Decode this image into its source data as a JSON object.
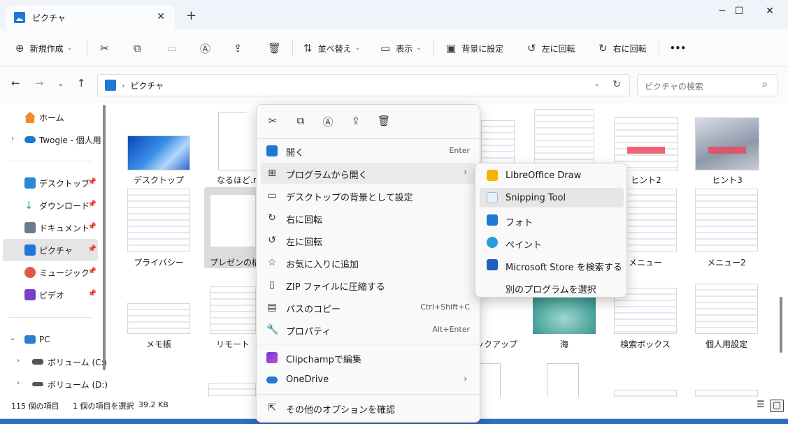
{
  "window": {
    "tab_title": "ピクチャ",
    "close_tab": "✕",
    "new_tab": "+",
    "minimize": "─",
    "maximize": "☐",
    "close": "✕"
  },
  "toolbar": {
    "new_label": "新規作成",
    "sort_label": "並べ替え",
    "view_label": "表示",
    "set_background_label": "背景に設定",
    "rotate_left_label": "左に回転",
    "rotate_right_label": "右に回転",
    "more_label": "•••"
  },
  "address": {
    "path": "ピクチャ",
    "search_placeholder": "ピクチャの検索"
  },
  "sidebar": {
    "items": [
      {
        "label": "ホーム",
        "color": "#f08c2a"
      },
      {
        "label": "Twogie - 個人用",
        "color": "#1e78d4"
      },
      {
        "label": "デスクトップ",
        "color": "#2b88d8"
      },
      {
        "label": "ダウンロード",
        "color": "#2e9c5a"
      },
      {
        "label": "ドキュメント",
        "color": "#6b7a8c"
      },
      {
        "label": "ピクチャ",
        "color": "#1e78d4"
      },
      {
        "label": "ミュージック",
        "color": "#e2574c"
      },
      {
        "label": "ビデオ",
        "color": "#7a3fc8"
      },
      {
        "label": "PC",
        "color": "#2a7fd0"
      },
      {
        "label": "ボリューム (C:)",
        "color": "#555555"
      },
      {
        "label": "ボリューム (D:)",
        "color": "#555555"
      }
    ]
  },
  "files": {
    "row1": [
      "デスクトップ",
      "なるほど.me",
      "",
      "",
      "ヒント2",
      "ヒント3"
    ],
    "row2": [
      "プライバシー",
      "プレゼンの構",
      "メニュー",
      "メニュー2"
    ],
    "row3": [
      "メモ帳",
      "リモート",
      "ックアップ",
      "海",
      "検索ボックス",
      "個人用設定"
    ]
  },
  "status": {
    "count": "115 個の項目",
    "selection": "1 個の項目を選択",
    "size": "39.2 KB"
  },
  "context_menu": {
    "items": [
      {
        "label": "開く",
        "shortcut": "Enter"
      },
      {
        "label": "プログラムから開く",
        "shortcut": "›"
      },
      {
        "label": "デスクトップの背景として設定",
        "shortcut": ""
      },
      {
        "label": "右に回転",
        "shortcut": ""
      },
      {
        "label": "左に回転",
        "shortcut": ""
      },
      {
        "label": "お気に入りに追加",
        "shortcut": ""
      },
      {
        "label": "ZIP ファイルに圧縮する",
        "shortcut": ""
      },
      {
        "label": "パスのコピー",
        "shortcut": "Ctrl+Shift+C"
      },
      {
        "label": "プロパティ",
        "shortcut": "Alt+Enter"
      },
      {
        "label": "Clipchampで編集",
        "shortcut": ""
      },
      {
        "label": "OneDrive",
        "shortcut": "›"
      },
      {
        "label": "その他のオプションを確認",
        "shortcut": ""
      }
    ]
  },
  "open_with_menu": {
    "items": [
      {
        "label": "LibreOffice Draw",
        "color": "#f5b400"
      },
      {
        "label": "Snipping Tool",
        "color": "#e8f0fa"
      },
      {
        "label": "フォト",
        "color": "#1e78d4"
      },
      {
        "label": "ペイント",
        "color": "#2a9ad8"
      },
      {
        "label": "Microsoft Store を検索する",
        "color": "#1e5fbf"
      },
      {
        "label": "別のプログラムを選択",
        "color": ""
      }
    ]
  }
}
